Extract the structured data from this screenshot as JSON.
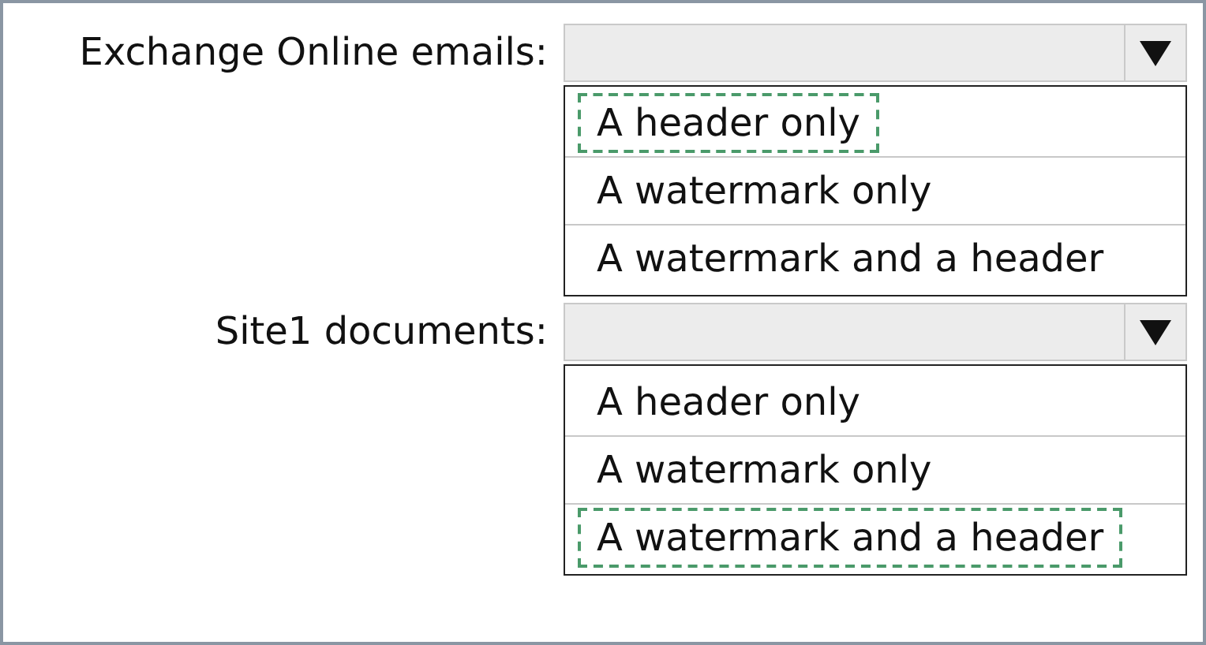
{
  "questions": [
    {
      "label": "Exchange Online emails:",
      "options": [
        {
          "text": "A header only",
          "selected": true
        },
        {
          "text": "A watermark only",
          "selected": false
        },
        {
          "text": "A watermark and a header",
          "selected": false
        }
      ]
    },
    {
      "label": "Site1 documents:",
      "options": [
        {
          "text": "A header only",
          "selected": false
        },
        {
          "text": "A watermark only",
          "selected": false
        },
        {
          "text": "A watermark and a header",
          "selected": true
        }
      ]
    }
  ]
}
